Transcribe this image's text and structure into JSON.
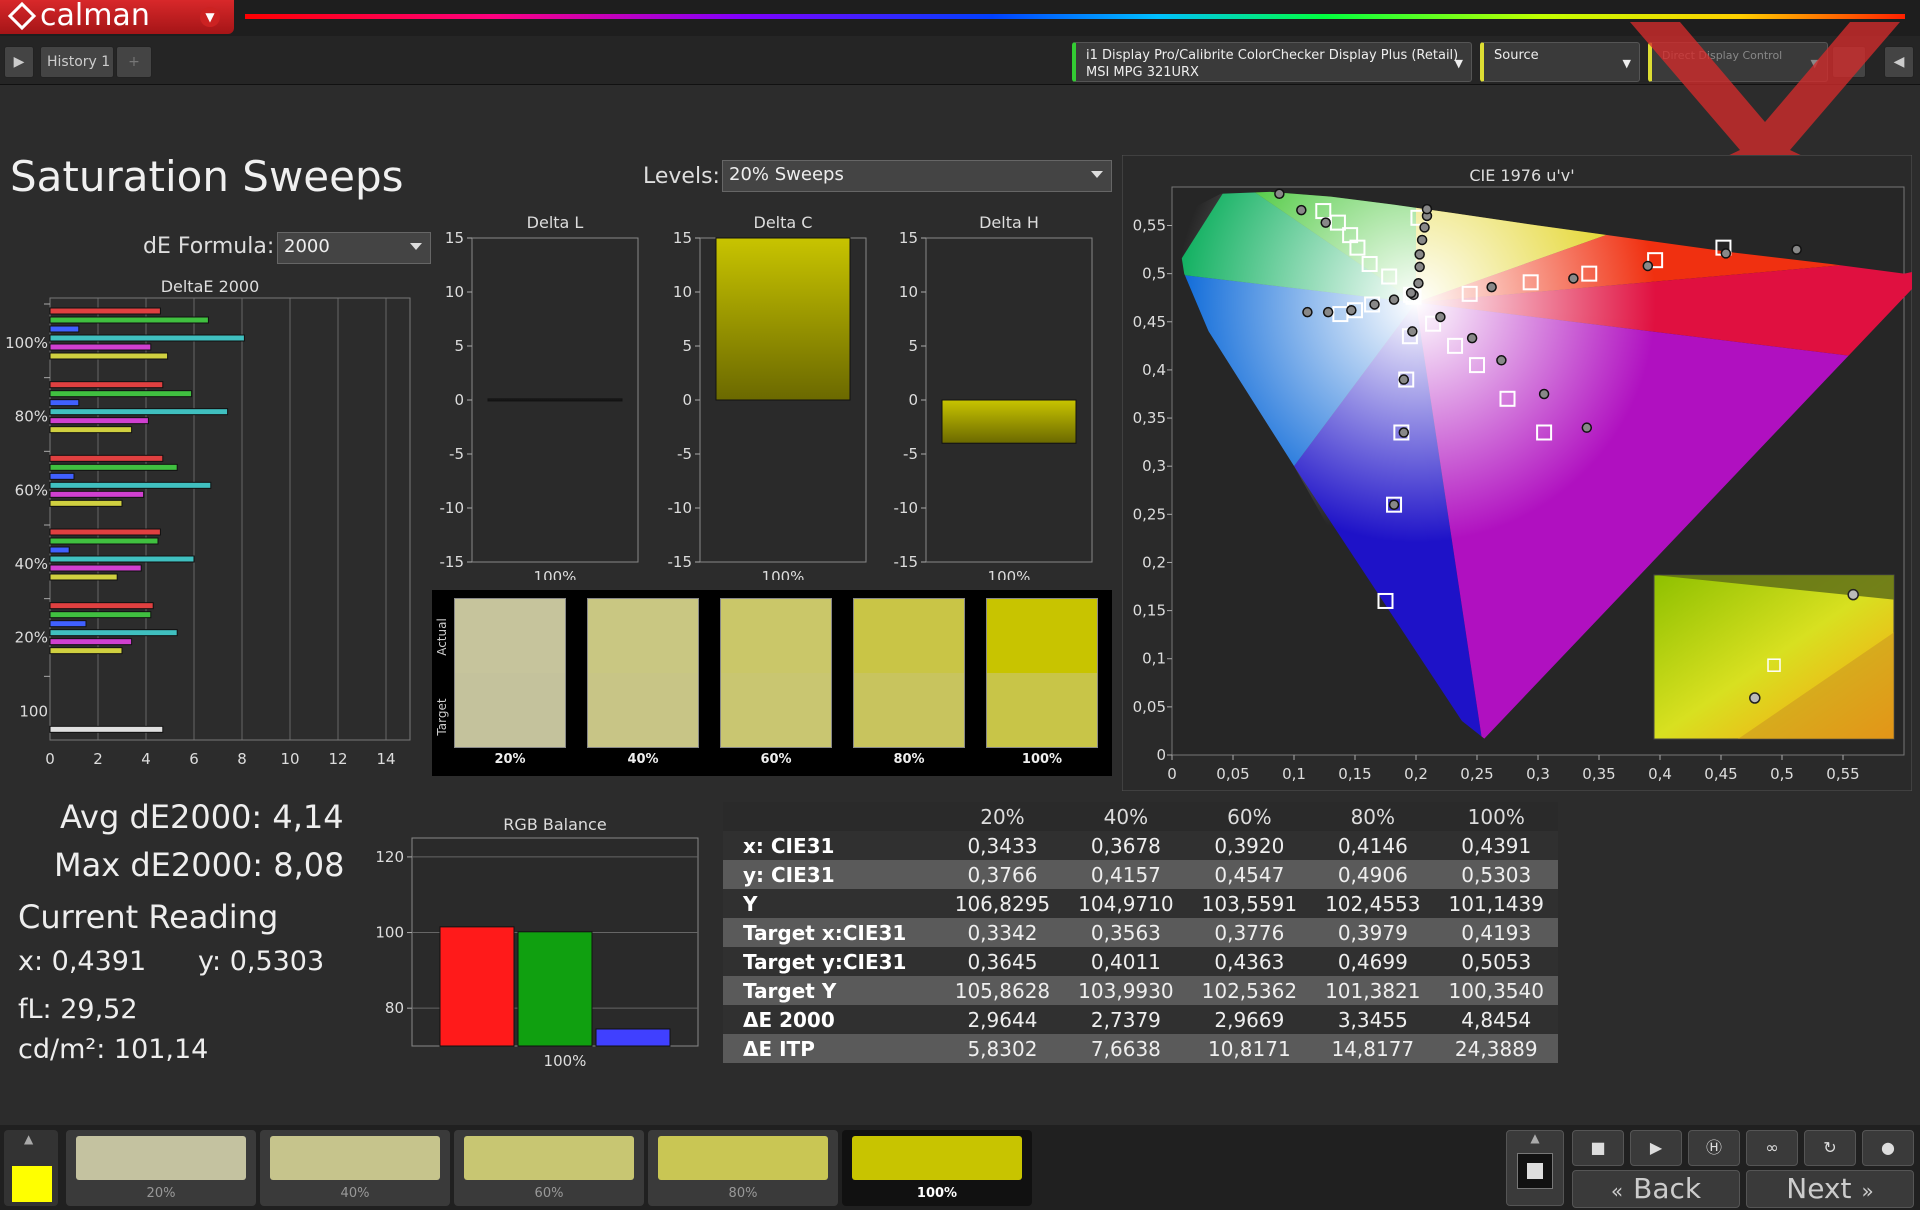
{
  "app": {
    "logo": "calman"
  },
  "tabs": {
    "history": "History 1",
    "add": "+"
  },
  "devices": {
    "meter_line1": "i1 Display Pro/Calibrite ColorChecker Display Plus (Retail)",
    "meter_line2": "MSI MPG 321URX",
    "source": "Source",
    "display_control": "Direct Display Control"
  },
  "page": {
    "title": "Saturation Sweeps",
    "levels_label": "Levels:",
    "levels_value": "20% Sweeps",
    "de_formula_label": "dE Formula:",
    "de_formula_value": "2000"
  },
  "summary": {
    "avg": "Avg dE2000: 4,14",
    "max": "Max dE2000: 8,08",
    "current_reading": "Current Reading",
    "x": "x: 0,4391",
    "y": "y: 0,5303",
    "fl": "fL: 29,52",
    "cdm2": "cd/m²: 101,14"
  },
  "swatch_panel": {
    "actual_label": "Actual",
    "target_label": "Target"
  },
  "swatches": [
    {
      "label": "20%",
      "actual": "#c6c49c",
      "target": "#c4c29c"
    },
    {
      "label": "40%",
      "actual": "#c9c782",
      "target": "#c8c586"
    },
    {
      "label": "60%",
      "actual": "#cac769",
      "target": "#c9c671"
    },
    {
      "label": "80%",
      "actual": "#c9c546",
      "target": "#c8c45e"
    },
    {
      "label": "100%",
      "actual": "#c8c400",
      "target": "#c8c548"
    }
  ],
  "table": {
    "headers": [
      "",
      "20%",
      "40%",
      "60%",
      "80%",
      "100%"
    ],
    "rows": [
      [
        "x: CIE31",
        "0,3433",
        "0,3678",
        "0,3920",
        "0,4146",
        "0,4391"
      ],
      [
        "y: CIE31",
        "0,3766",
        "0,4157",
        "0,4547",
        "0,4906",
        "0,5303"
      ],
      [
        "Y",
        "106,8295",
        "104,9710",
        "103,5591",
        "102,4553",
        "101,1439"
      ],
      [
        "Target x:CIE31",
        "0,3342",
        "0,3563",
        "0,3776",
        "0,3979",
        "0,4193"
      ],
      [
        "Target y:CIE31",
        "0,3645",
        "0,4011",
        "0,4363",
        "0,4699",
        "0,5053"
      ],
      [
        "Target Y",
        "105,8628",
        "103,9930",
        "102,5362",
        "101,3821",
        "100,3540"
      ],
      [
        "ΔE 2000",
        "2,9644",
        "2,7379",
        "2,9669",
        "3,3455",
        "4,8454"
      ],
      [
        "ΔE ITP",
        "5,8302",
        "7,6638",
        "10,8171",
        "14,8177",
        "24,3889"
      ]
    ]
  },
  "bottom": {
    "swatches": [
      {
        "label": "20%",
        "color": "#c4c2a0"
      },
      {
        "label": "40%",
        "color": "#c6c48c"
      },
      {
        "label": "60%",
        "color": "#c8c672"
      },
      {
        "label": "80%",
        "color": "#c9c654"
      },
      {
        "label": "100%",
        "color": "#c8c400"
      }
    ],
    "current_color": "#ffff00",
    "back": "Back",
    "next": "Next"
  },
  "chart_data": [
    {
      "type": "bar",
      "title": "DeltaE 2000",
      "orientation": "horizontal",
      "xlim": [
        0,
        15
      ],
      "xticks": [
        0,
        2,
        4,
        6,
        8,
        10,
        12,
        14
      ],
      "group_labels": [
        "100%",
        "80%",
        "60%",
        "40%",
        "20%",
        "100"
      ],
      "groups": [
        {
          "label": "100%",
          "bars": [
            {
              "value": 4.6,
              "color": "#e04040"
            },
            {
              "value": 6.6,
              "color": "#40c040"
            },
            {
              "value": 1.2,
              "color": "#4060ff"
            },
            {
              "value": 8.1,
              "color": "#40c0c0"
            },
            {
              "value": 4.2,
              "color": "#d040d0"
            },
            {
              "value": 4.9,
              "color": "#d0d040"
            }
          ]
        },
        {
          "label": "80%",
          "bars": [
            {
              "value": 4.7,
              "color": "#e04040"
            },
            {
              "value": 5.9,
              "color": "#40c040"
            },
            {
              "value": 1.2,
              "color": "#4060ff"
            },
            {
              "value": 7.4,
              "color": "#40c0c0"
            },
            {
              "value": 4.1,
              "color": "#d040d0"
            },
            {
              "value": 3.4,
              "color": "#d0d040"
            }
          ]
        },
        {
          "label": "60%",
          "bars": [
            {
              "value": 4.7,
              "color": "#e04040"
            },
            {
              "value": 5.3,
              "color": "#40c040"
            },
            {
              "value": 1.0,
              "color": "#4060ff"
            },
            {
              "value": 6.7,
              "color": "#40c0c0"
            },
            {
              "value": 3.9,
              "color": "#d040d0"
            },
            {
              "value": 3.0,
              "color": "#d0d040"
            }
          ]
        },
        {
          "label": "40%",
          "bars": [
            {
              "value": 4.6,
              "color": "#e04040"
            },
            {
              "value": 4.5,
              "color": "#40c040"
            },
            {
              "value": 0.8,
              "color": "#4060ff"
            },
            {
              "value": 6.0,
              "color": "#40c0c0"
            },
            {
              "value": 3.8,
              "color": "#d040d0"
            },
            {
              "value": 2.8,
              "color": "#d0d040"
            }
          ]
        },
        {
          "label": "20%",
          "bars": [
            {
              "value": 4.3,
              "color": "#e04040"
            },
            {
              "value": 4.2,
              "color": "#40c040"
            },
            {
              "value": 1.5,
              "color": "#4060ff"
            },
            {
              "value": 5.3,
              "color": "#40c0c0"
            },
            {
              "value": 3.4,
              "color": "#d040d0"
            },
            {
              "value": 3.0,
              "color": "#d0d040"
            }
          ]
        },
        {
          "label": "100",
          "bars": [
            {
              "value": 4.7,
              "color": "#e0e0e0"
            }
          ]
        }
      ]
    },
    {
      "type": "bar",
      "title": "Delta L",
      "categories": [
        "100%"
      ],
      "values": [
        0.1
      ],
      "ylim": [
        -15,
        15
      ],
      "yticks": [
        15,
        10,
        5,
        0,
        -5,
        -10,
        -15
      ],
      "color": "#222222"
    },
    {
      "type": "bar",
      "title": "Delta C",
      "categories": [
        "100%"
      ],
      "values": [
        15
      ],
      "ylim": [
        -15,
        15
      ],
      "yticks": [
        15,
        10,
        5,
        0,
        -5,
        -10,
        -15
      ],
      "color": "#c8c400"
    },
    {
      "type": "bar",
      "title": "Delta H",
      "categories": [
        "100%"
      ],
      "values": [
        -4
      ],
      "ylim": [
        -15,
        15
      ],
      "yticks": [
        15,
        10,
        5,
        0,
        -5,
        -10,
        -15
      ],
      "color": "#c8c400"
    },
    {
      "type": "bar",
      "title": "RGB Balance",
      "categories": [
        "100%"
      ],
      "series": [
        {
          "name": "R",
          "values": [
            101.5
          ],
          "color": "#ff1a1a"
        },
        {
          "name": "G",
          "values": [
            100.2
          ],
          "color": "#10a010"
        },
        {
          "name": "B",
          "values": [
            74.5
          ],
          "color": "#4040ff"
        }
      ],
      "ylim": [
        70,
        125
      ],
      "yticks": [
        120,
        100,
        80
      ]
    },
    {
      "type": "scatter",
      "title": "CIE 1976 u'v'",
      "xlim": [
        0,
        0.6
      ],
      "ylim": [
        0,
        0.59
      ],
      "xticks": [
        "0",
        "0,05",
        "0,1",
        "0,15",
        "0,2",
        "0,25",
        "0,3",
        "0,35",
        "0,4",
        "0,45",
        "0,5",
        "0,55"
      ],
      "yticks": [
        "0",
        "0,05",
        "0,1",
        "0,15",
        "0,2",
        "0,25",
        "0,3",
        "0,35",
        "0,4",
        "0,45",
        "0,5",
        "0,55"
      ],
      "targets": [
        [
          0.124,
          0.565
        ],
        [
          0.136,
          0.553
        ],
        [
          0.146,
          0.54
        ],
        [
          0.152,
          0.527
        ],
        [
          0.162,
          0.51
        ],
        [
          0.178,
          0.497
        ],
        [
          0.196,
          0.478
        ],
        [
          0.138,
          0.458
        ],
        [
          0.15,
          0.462
        ],
        [
          0.164,
          0.468
        ],
        [
          0.198,
          0.476
        ],
        [
          0.214,
          0.448
        ],
        [
          0.244,
          0.479
        ],
        [
          0.294,
          0.491
        ],
        [
          0.342,
          0.5
        ],
        [
          0.396,
          0.514
        ],
        [
          0.452,
          0.527
        ],
        [
          0.195,
          0.435
        ],
        [
          0.232,
          0.425
        ],
        [
          0.25,
          0.405
        ],
        [
          0.275,
          0.37
        ],
        [
          0.305,
          0.335
        ],
        [
          0.192,
          0.39
        ],
        [
          0.188,
          0.335
        ],
        [
          0.182,
          0.26
        ],
        [
          0.175,
          0.16
        ],
        [
          0.202,
          0.558
        ]
      ],
      "measured": [
        [
          0.088,
          0.583
        ],
        [
          0.106,
          0.566
        ],
        [
          0.126,
          0.553
        ],
        [
          0.111,
          0.46
        ],
        [
          0.128,
          0.46
        ],
        [
          0.147,
          0.462
        ],
        [
          0.166,
          0.468
        ],
        [
          0.182,
          0.473
        ],
        [
          0.198,
          0.478
        ],
        [
          0.202,
          0.49
        ],
        [
          0.203,
          0.507
        ],
        [
          0.203,
          0.52
        ],
        [
          0.205,
          0.535
        ],
        [
          0.207,
          0.548
        ],
        [
          0.209,
          0.56
        ],
        [
          0.209,
          0.567
        ],
        [
          0.196,
          0.48
        ],
        [
          0.22,
          0.455
        ],
        [
          0.197,
          0.44
        ],
        [
          0.246,
          0.433
        ],
        [
          0.262,
          0.486
        ],
        [
          0.329,
          0.495
        ],
        [
          0.39,
          0.508
        ],
        [
          0.454,
          0.521
        ],
        [
          0.512,
          0.525
        ],
        [
          0.27,
          0.41
        ],
        [
          0.305,
          0.375
        ],
        [
          0.34,
          0.34
        ],
        [
          0.19,
          0.39
        ],
        [
          0.19,
          0.335
        ],
        [
          0.182,
          0.26
        ]
      ],
      "inset": {
        "targets": [
          [
            0.5,
            0.45
          ]
        ],
        "measured": [
          [
            0.83,
            0.88
          ],
          [
            0.42,
            0.25
          ]
        ]
      }
    }
  ]
}
